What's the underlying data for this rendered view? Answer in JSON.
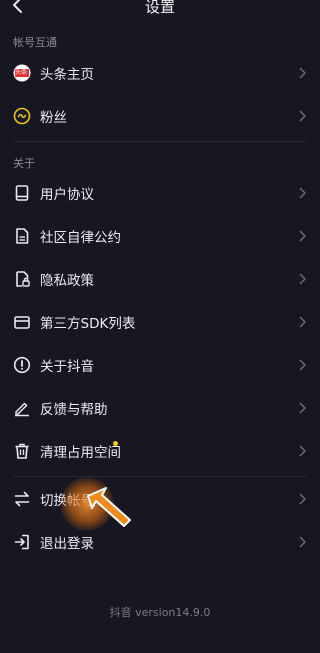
{
  "header": {
    "title": "设置"
  },
  "sections": {
    "account": "帐号互通",
    "about": "关于"
  },
  "account_items": [
    {
      "label": "头条主页",
      "icon": "toutiao-logo-icon",
      "icon_text": "头条"
    },
    {
      "label": "粉丝",
      "icon": "fans-icon"
    }
  ],
  "about_items": [
    {
      "label": "用户协议",
      "icon": "book-icon"
    },
    {
      "label": "社区自律公约",
      "icon": "document-icon"
    },
    {
      "label": "隐私政策",
      "icon": "privacy-lock-icon"
    },
    {
      "label": "第三方SDK列表",
      "icon": "wallet-icon"
    },
    {
      "label": "关于抖音",
      "icon": "info-icon"
    },
    {
      "label": "反馈与帮助",
      "icon": "pencil-icon"
    },
    {
      "label": "清理占用空间",
      "icon": "trash-icon",
      "badge_dot": true
    }
  ],
  "account_actions": [
    {
      "label": "切换帐号",
      "icon": "switch-icon"
    },
    {
      "label": "退出登录",
      "icon": "logout-icon"
    }
  ],
  "footer": {
    "version": "抖音 version14.9.0"
  },
  "colors": {
    "background": "#161721",
    "accent_dot": "#f8c81c",
    "toutiao_red": "#e5312e",
    "cursor": "#f08a1c"
  }
}
